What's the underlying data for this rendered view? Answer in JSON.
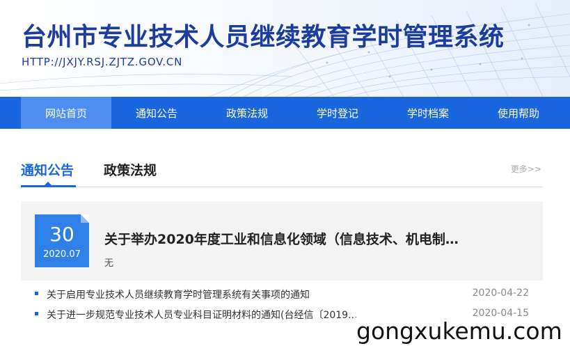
{
  "header": {
    "site_title": "台州市专业技术人员继续教育学时管理系统",
    "site_url": "HTTP://JXJY.RSJ.ZJTZ.GOV.CN"
  },
  "nav": {
    "items": [
      {
        "label": "网站首页",
        "active": true
      },
      {
        "label": "通知公告",
        "active": false
      },
      {
        "label": "政策法规",
        "active": false
      },
      {
        "label": "学时登记",
        "active": false
      },
      {
        "label": "学时档案",
        "active": false
      },
      {
        "label": "使用帮助",
        "active": false
      }
    ]
  },
  "tabs": {
    "items": [
      {
        "label": "通知公告",
        "active": true
      },
      {
        "label": "政策法规",
        "active": false
      }
    ],
    "more_label": "更多>>"
  },
  "featured": {
    "day": "30",
    "year_month": "2020.07",
    "title": "关于举办2020年度工业和信息化领域（信息技术、机电制…",
    "subtitle": "无"
  },
  "list": {
    "items": [
      {
        "title": "关于启用专业技术人员继续教育学时管理系统有关事项的通知",
        "date": "2020-04-22"
      },
      {
        "title": "关于进一步规范专业技术人员专业科目证明材料的通知(台经信〔2019...",
        "date": "2020-04-15"
      }
    ]
  },
  "watermark": "gongxukemu.com",
  "colors": {
    "brand_blue": "#1a66de",
    "title_blue": "#1c3d9e",
    "nav_active": "#4d8ef0",
    "date_box": "#2f81e8"
  }
}
